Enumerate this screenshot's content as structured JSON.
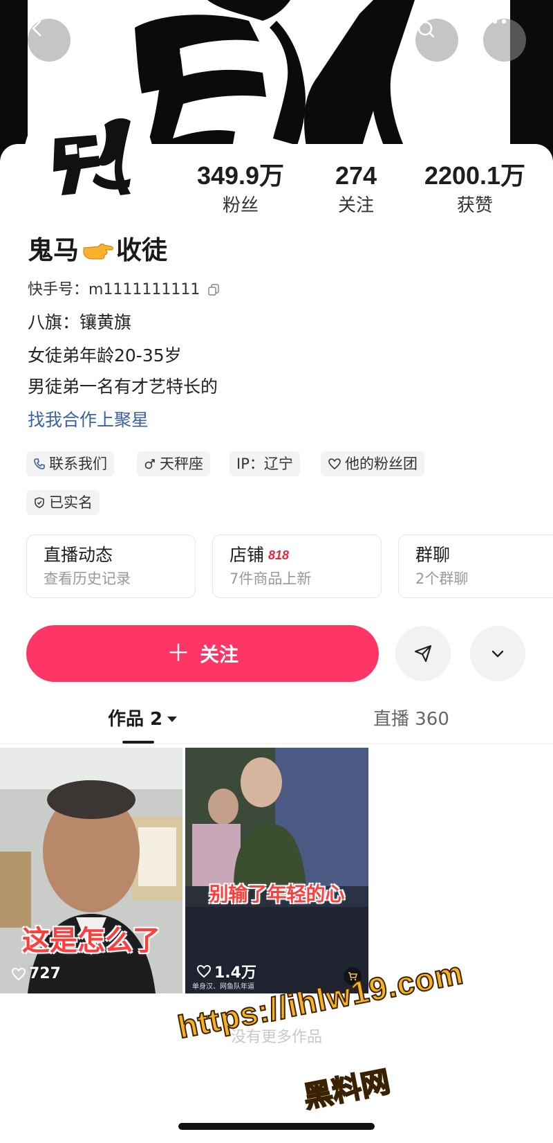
{
  "header": {
    "back_icon": "chevron-left-icon",
    "search_icon": "search-icon",
    "more_icon": "more-dots-icon"
  },
  "stats": {
    "fans_value": "349.9万",
    "fans_label": "粉丝",
    "following_value": "274",
    "following_label": "关注",
    "likes_value": "2200.1万",
    "likes_label": "获赞"
  },
  "profile": {
    "name_part1": "鬼马",
    "name_part2": "收徒",
    "name_emoji": "pointing-hand-emoji",
    "kuaishou_id": "快手号：m1111111111",
    "bio_line1": "八旗：镶黄旗",
    "bio_line2": "女徒弟年龄20-35岁",
    "bio_line3": "男徒弟一名有才艺特长的",
    "coop_link": "找我合作上聚星"
  },
  "tags": {
    "contact": "联系我们",
    "zodiac": "天秤座",
    "ip": "IP：辽宁",
    "fan_group": "他的粉丝团",
    "verified": "已实名"
  },
  "quick_entries": {
    "live_title": "直播动态",
    "live_sub": "查看历史记录",
    "shop_title": "店铺",
    "shop_badge": "818",
    "shop_sub": "7件商品上新",
    "group_title": "群聊",
    "group_sub": "2个群聊"
  },
  "actions": {
    "follow_plus": "＋",
    "follow_label": "关注"
  },
  "tabs": {
    "works": "作品 2",
    "live": "直播 360"
  },
  "videos": [
    {
      "caption": "这是怎么了",
      "likes": "727"
    },
    {
      "caption": "别输了年轻的心",
      "likes": "1.4万",
      "small_caption": "单身汉、网鱼队年逼"
    }
  ],
  "footer": {
    "no_more": "没有更多作品"
  },
  "watermark": {
    "url": "https://ihlw19.com",
    "name": "黑料网"
  },
  "colors": {
    "accent": "#fe3666",
    "link": "#3a61a3"
  }
}
